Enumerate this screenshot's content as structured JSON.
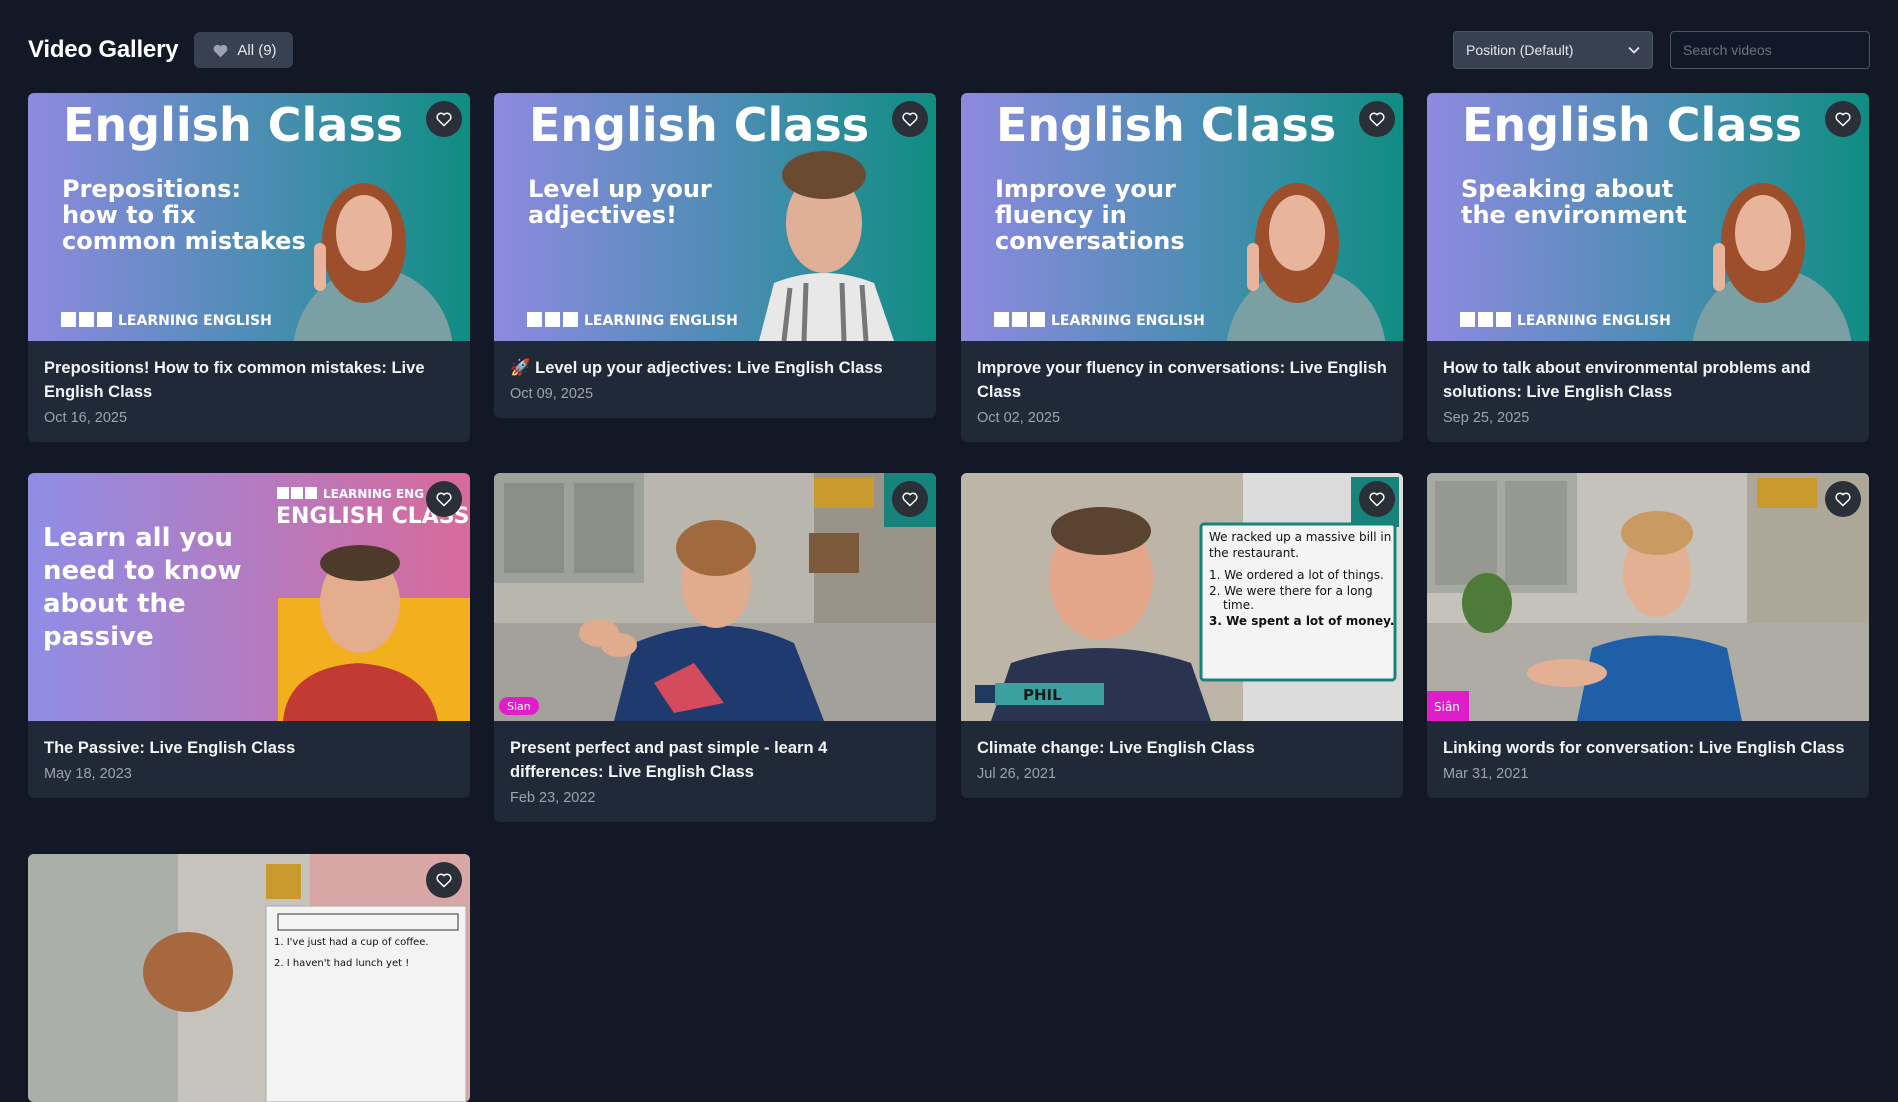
{
  "header": {
    "title": "Video Gallery",
    "filter_label": "All (9)",
    "sort_label": "Position (Default)",
    "search_placeholder": "Search videos"
  },
  "thumb_text": {
    "class_heading": "English Class",
    "brand": "LEARNING ENGLISH",
    "brand_short": "LEARNING ENG",
    "bbc_letters": [
      "B",
      "B",
      "C"
    ],
    "card1_lines": [
      "Prepositions:",
      "how to fix",
      "common mistakes"
    ],
    "card2_lines": [
      "Level up your",
      "adjectives!"
    ],
    "card3_lines": [
      "Improve your",
      "fluency in",
      "conversations"
    ],
    "card4_lines": [
      "Speaking about",
      "the environment"
    ],
    "card5_heading": "ENGLISH CLASS",
    "card5_lines": [
      "Learn all you",
      "need to know",
      "about the",
      "passive"
    ],
    "card6_tag": "Sian",
    "card7_name": "PHIL",
    "card7_board": [
      "We racked up a massive bill in",
      "the restaurant.",
      "1. We ordered a lot of things.",
      "2. We were there for a long",
      "time.",
      "3. We spent a lot of money."
    ],
    "card8_tag": "Siân",
    "card9_board": [
      "1. I've just had a cup of coffee.",
      "2. I haven't had lunch yet !"
    ]
  },
  "videos": [
    {
      "title": "Prepositions! How to fix common mistakes: Live English Class",
      "date": "Oct 16, 2025"
    },
    {
      "title": "🚀 Level up your adjectives: Live English Class",
      "date": "Oct 09, 2025"
    },
    {
      "title": "Improve your fluency in conversations: Live English Class",
      "date": "Oct 02, 2025"
    },
    {
      "title": "How to talk about environmental problems and solutions: Live English Class",
      "date": "Sep 25, 2025"
    },
    {
      "title": "The Passive: Live English Class",
      "date": "May 18, 2023"
    },
    {
      "title": "Present perfect and past simple - learn 4 differences: Live English Class",
      "date": "Feb 23, 2022"
    },
    {
      "title": "Climate change: Live English Class",
      "date": "Jul 26, 2021"
    },
    {
      "title": "Linking words for conversation: Live English Class",
      "date": "Mar 31, 2021"
    },
    {
      "title": "",
      "date": ""
    }
  ],
  "colors": {
    "background": "#121826",
    "card": "#1f2937",
    "muted_text": "#9ca3af",
    "tag_pink": "#e11dcb"
  }
}
